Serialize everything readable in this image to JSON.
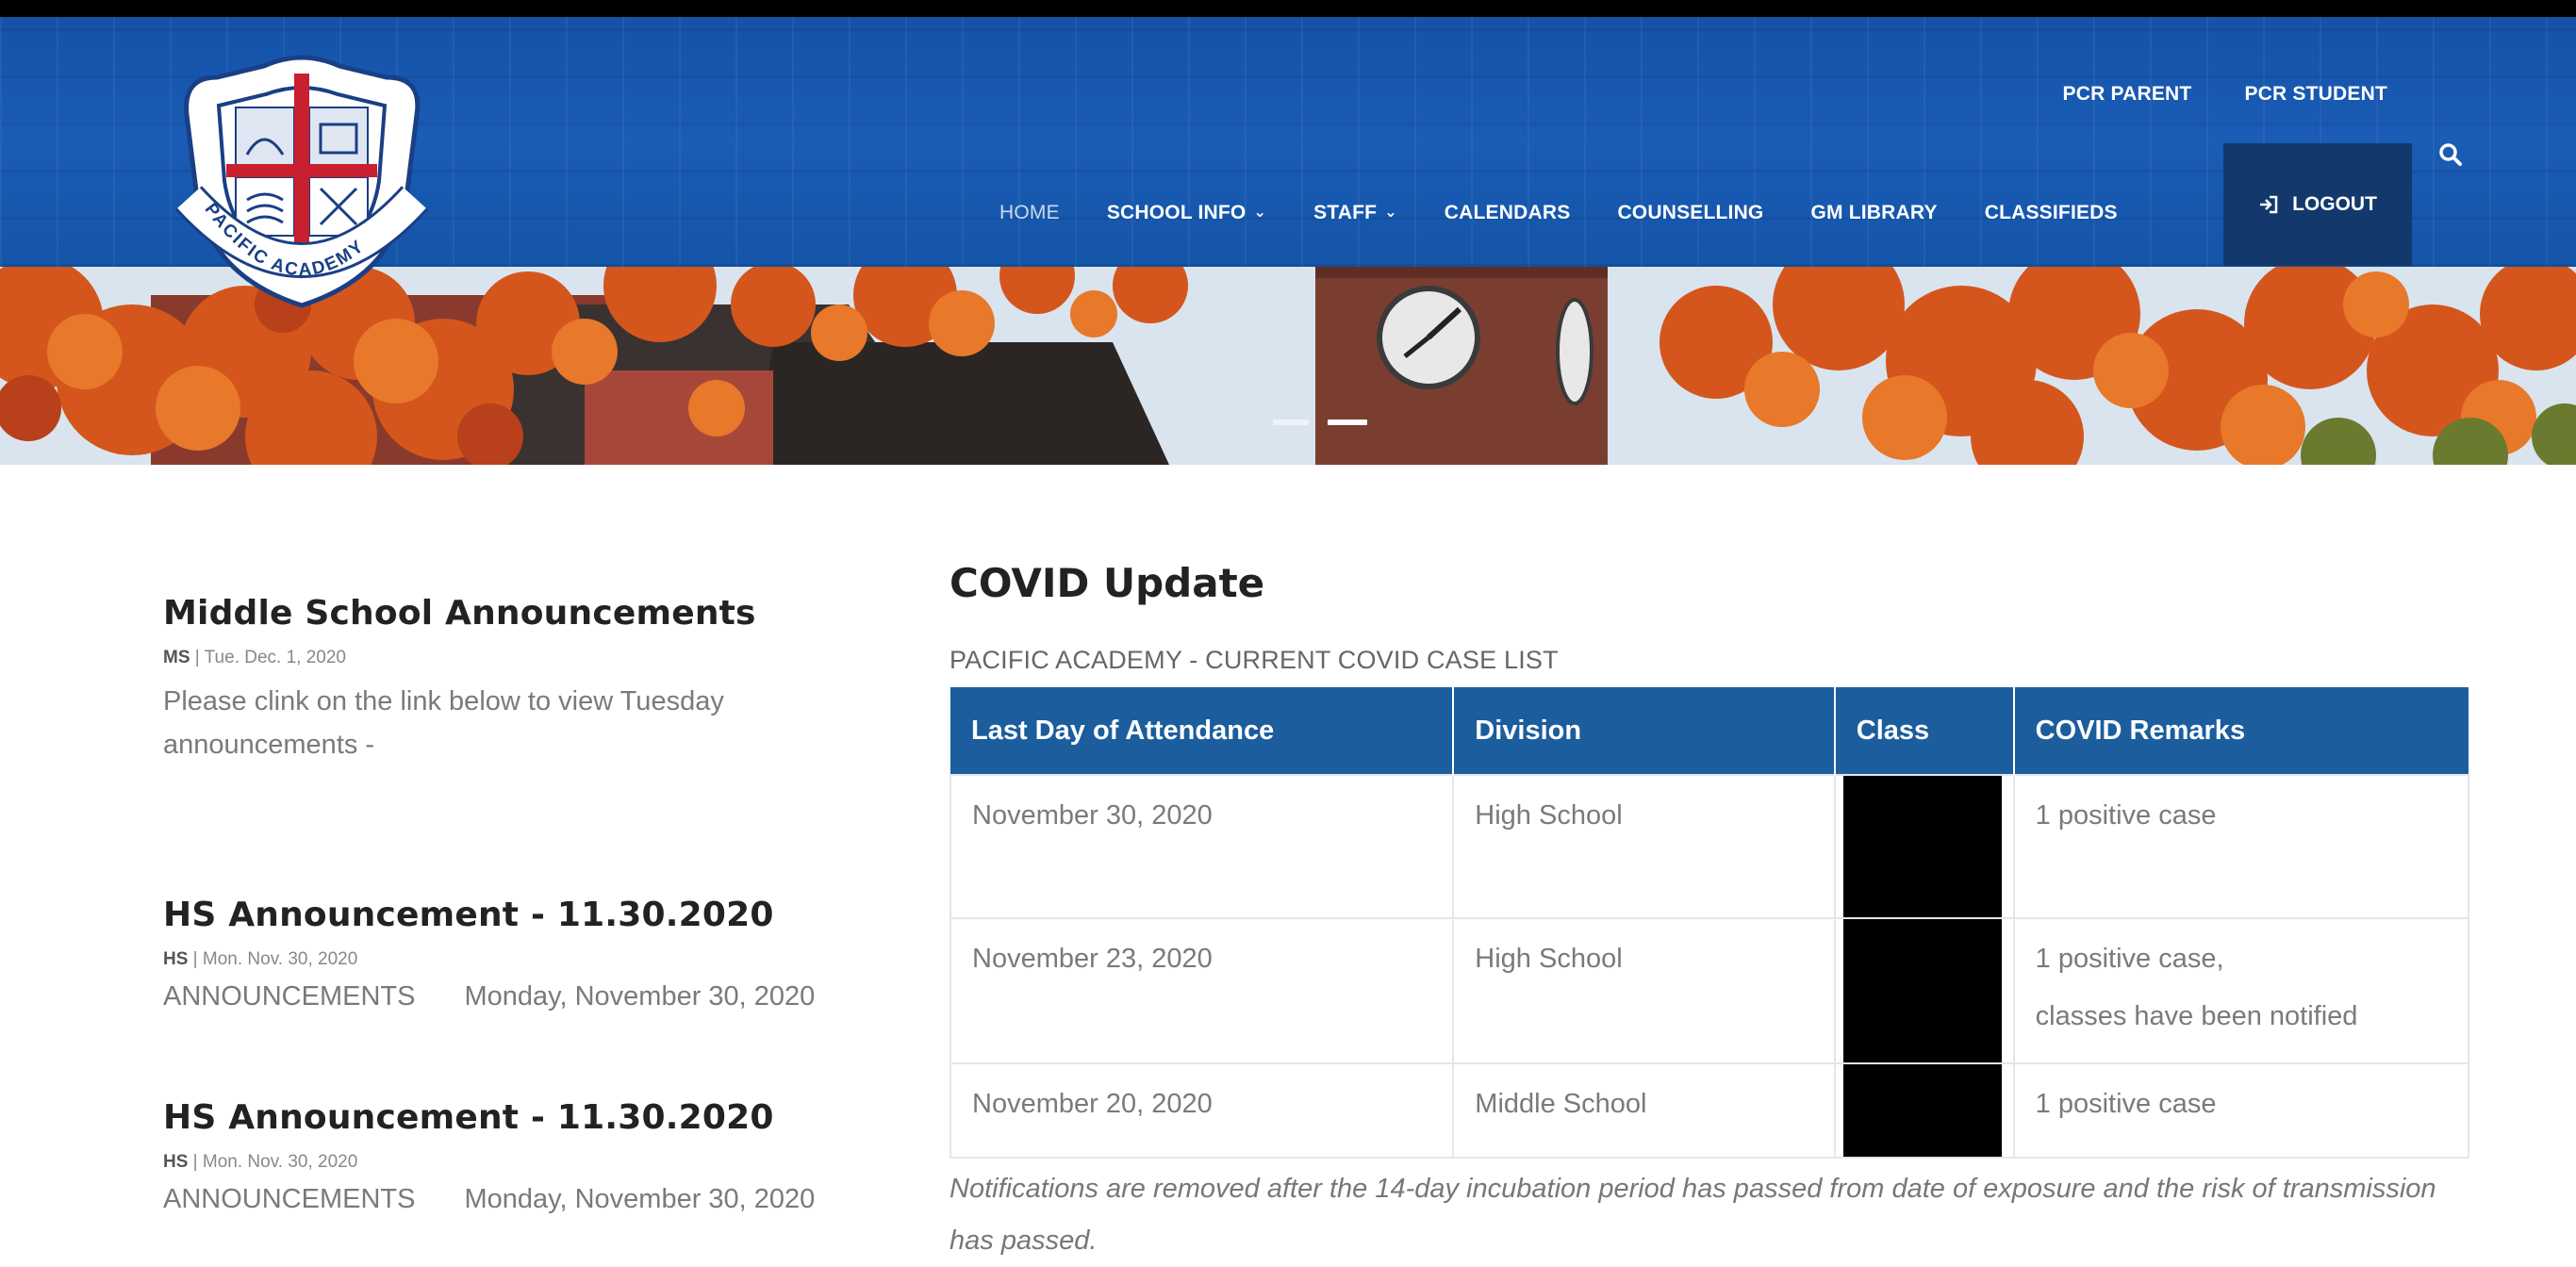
{
  "header": {
    "logo_text": "PACIFIC ACADEMY",
    "top_links": [
      "PCR PARENT",
      "PCR STUDENT"
    ],
    "nav": [
      {
        "label": "HOME",
        "dropdown": false
      },
      {
        "label": "SCHOOL INFO",
        "dropdown": true
      },
      {
        "label": "STAFF",
        "dropdown": true
      },
      {
        "label": "CALENDARS",
        "dropdown": false
      },
      {
        "label": "COUNSELLING",
        "dropdown": false
      },
      {
        "label": "GM LIBRARY",
        "dropdown": false
      },
      {
        "label": "CLASSIFIEDS",
        "dropdown": false
      }
    ],
    "logout_label": "LOGOUT",
    "icons": [
      "search-icon",
      "logout-icon",
      "chevron-down-icon"
    ],
    "colors": {
      "header_blue": "#1a5cb6",
      "logout_bg": "#13396c",
      "table_header": "#1c5d9e"
    }
  },
  "sidebar": {
    "announcements": [
      {
        "title": "Middle School Announcements",
        "division": "MS",
        "date": "Tue. Dec. 1, 2020",
        "body": "Please clink on the link below to view Tuesday announcements -"
      },
      {
        "title": "HS Announcement - 11.30.2020",
        "division": "HS",
        "date": "Mon. Nov. 30, 2020",
        "label": "ANNOUNCEMENTS",
        "day": "Monday, November 30, 2020"
      },
      {
        "title": "HS Announcement - 11.30.2020",
        "division": "HS",
        "date": "Mon. Nov. 30, 2020",
        "label": "ANNOUNCEMENTS",
        "day": "Monday, November 30, 2020"
      }
    ]
  },
  "main": {
    "title": "COVID Update",
    "subtitle": "PACIFIC ACADEMY - CURRENT COVID CASE LIST",
    "table": {
      "columns": [
        "Last Day of Attendance",
        "Division",
        "Class",
        "COVID Remarks"
      ],
      "rows": [
        {
          "date": "November 30, 2020",
          "division": "High School",
          "class": "",
          "remarks": [
            "1 positive case"
          ]
        },
        {
          "date": "November 23, 2020",
          "division": "High School",
          "class": "",
          "remarks": [
            "1 positive case,",
            "classes have been notified"
          ]
        },
        {
          "date": "November 20, 2020",
          "division": "Middle School",
          "class": "",
          "remarks": [
            "1 positive case"
          ]
        }
      ]
    },
    "footnote": "Notifications are removed after the 14-day incubation period has passed from date of exposure and the risk of transmission has passed."
  }
}
